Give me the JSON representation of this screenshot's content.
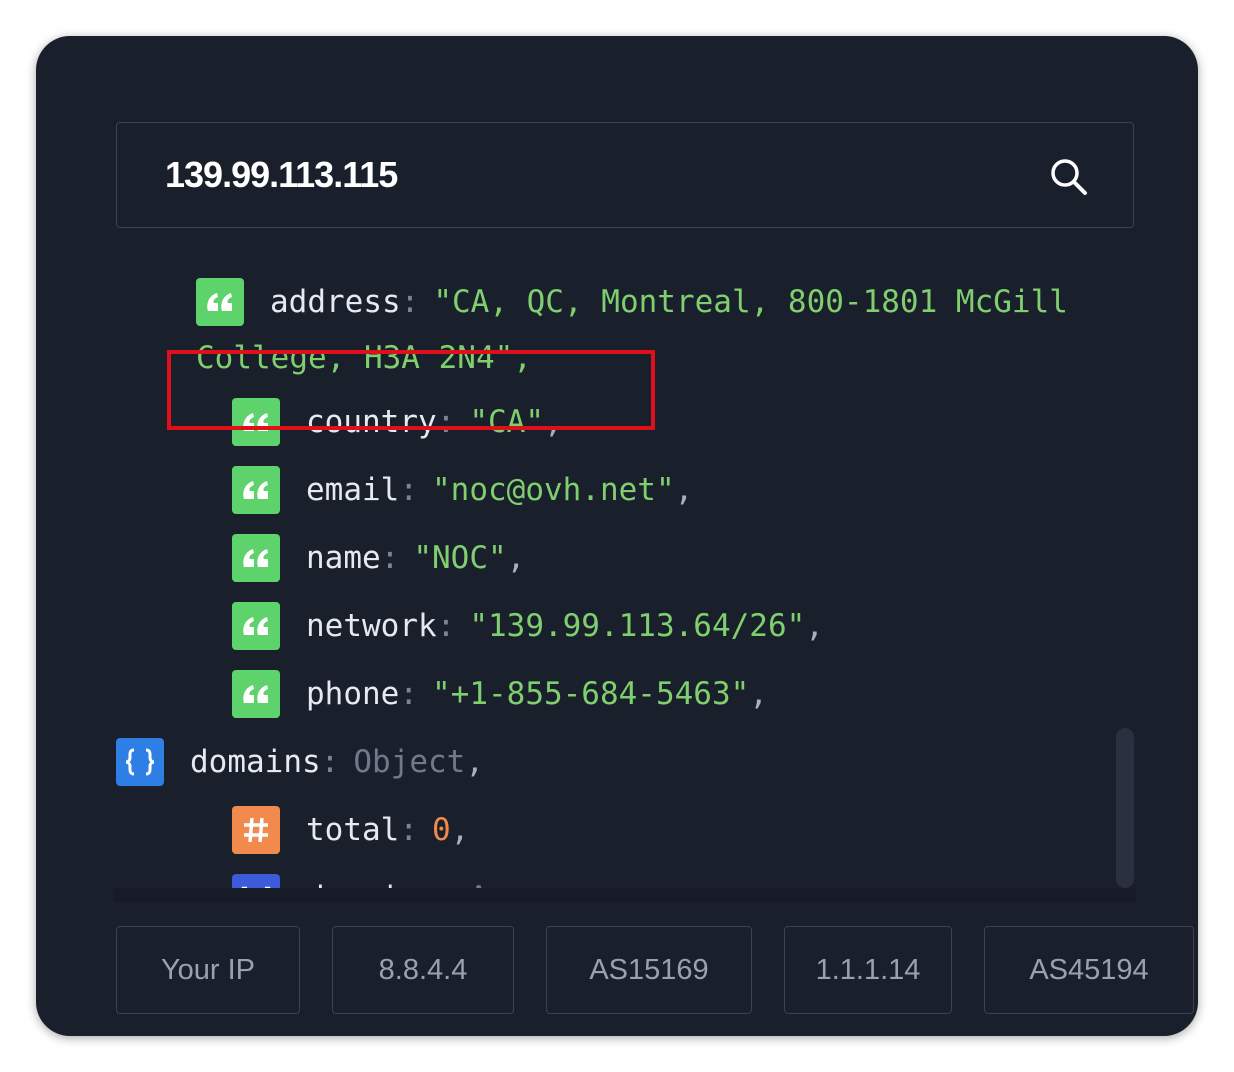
{
  "search": {
    "value": "139.99.113.115",
    "icon": "search-icon"
  },
  "tree": {
    "address_key": "address",
    "address_value_line1": "\"CA, QC, Montreal, 800-1801 McGill",
    "address_value_line2": "College, H3A 2N4\",",
    "rows": [
      {
        "key": "country",
        "value": "\"CA\"",
        "type": "string"
      },
      {
        "key": "email",
        "value": "\"noc@ovh.net\"",
        "type": "string"
      },
      {
        "key": "name",
        "value": "\"NOC\"",
        "type": "string"
      },
      {
        "key": "network",
        "value": "\"139.99.113.64/26\"",
        "type": "string"
      },
      {
        "key": "phone",
        "value": "\"+1-855-684-5463\"",
        "type": "string"
      }
    ],
    "domains": {
      "key": "domains",
      "value": "Object",
      "type": "object"
    },
    "domain_children": [
      {
        "key": "total",
        "value": "0",
        "type": "number"
      },
      {
        "key": "domains",
        "value": "Array",
        "type": "array"
      }
    ]
  },
  "chips": [
    "Your IP",
    "8.8.4.4",
    "AS15169",
    "1.1.1.14",
    "AS45194"
  ],
  "colors": {
    "string_badge": "#5ed36b",
    "number_badge": "#f28a4e",
    "object_badge": "#2d7fe6",
    "array_badge": "#3b5bd9",
    "highlight": "#e0101a",
    "background": "#1a1f2c"
  }
}
